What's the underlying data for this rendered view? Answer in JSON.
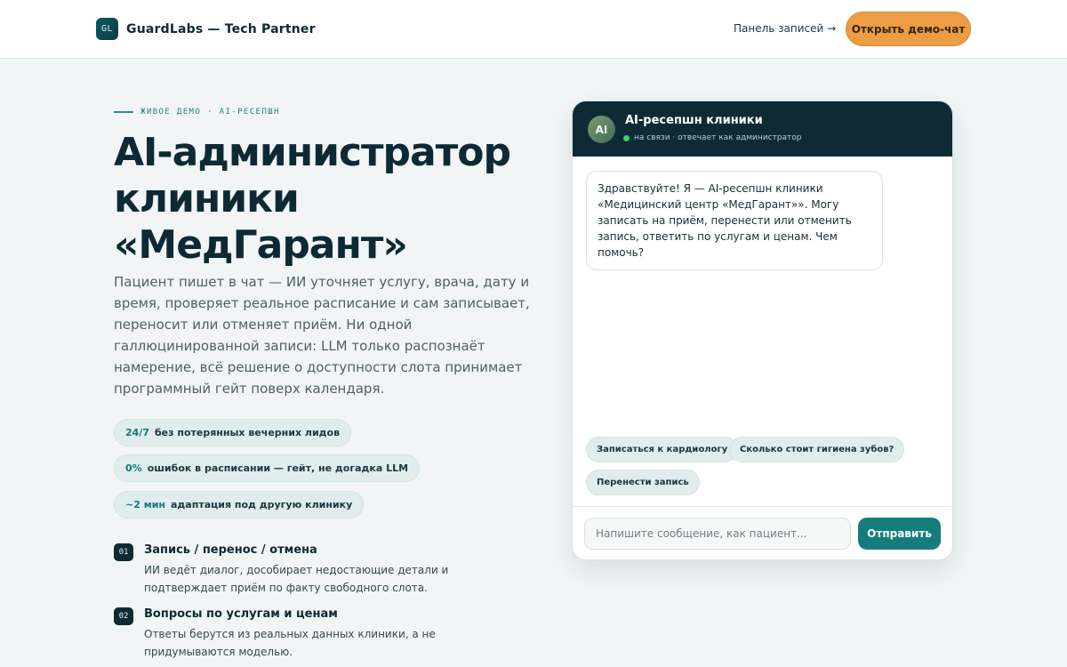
{
  "header": {
    "logo_mark": "GL",
    "brand": "GuardLabs — Tech Partner",
    "nav_link": "Панель записей →",
    "cta_label": "Открыть демо-чат"
  },
  "hero": {
    "eyebrow": "ЖИВОЕ ДЕМО · AI-РЕСЕПШН",
    "title": "AI-администратор клиники «МедГарант»",
    "description": "Пациент пишет в чат — ИИ уточняет услугу, врача, дату и время, проверяет реальное расписание и сам записывает, переносит или отменяет приём. Ни одной галлюцинированной записи: LLM только распознаёт намерение, всё решение о доступности слота принимает программный гейт поверх календаря.",
    "stats": [
      {
        "value": "24/7",
        "label": "без потерянных вечерних лидов"
      },
      {
        "value": "0%",
        "label": "ошибок в расписании — гейт, не догадка LLM"
      },
      {
        "value": "~2 мин",
        "label": "адаптация под другую клинику"
      }
    ],
    "features": [
      {
        "num": "01",
        "title": "Запись / перенос / отмена",
        "text": "ИИ ведёт диалог, дособирает недостающие детали и подтверждает приём по факту свободного слота."
      },
      {
        "num": "02",
        "title": "Вопросы по услугам и ценам",
        "text": "Ответы берутся из реальных данных клиники, а не придумываются моделью."
      }
    ]
  },
  "chat": {
    "avatar": "AI",
    "title": "AI-ресепшн клиники",
    "status": "на связи · отвечает как администратор",
    "status_color": "#3bd26b",
    "greeting": "Здравствуйте! Я — AI-ресепшн клиники «Медицинский центр «МедГарант»». Могу записать на приём, перенести или отменить запись, ответить по услугам и ценам. Чем помочь?",
    "chips": [
      "Записаться к кардиологу",
      "Сколько стоит гигиена зубов?",
      "Перенести запись"
    ],
    "input_placeholder": "Напишите сообщение, как пациент...",
    "input_value": "",
    "send_label": "Отправить"
  },
  "colors": {
    "accent": "#157c7d",
    "cta": "#ec9d45",
    "dark": "#0e2a35",
    "background": "#f1f5f5"
  }
}
